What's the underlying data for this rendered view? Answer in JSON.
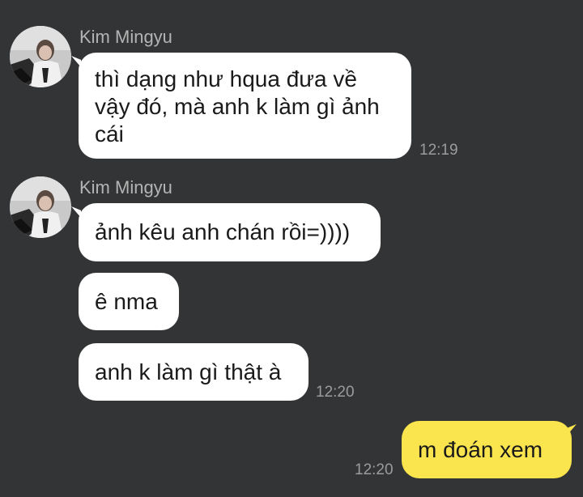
{
  "chat": {
    "groups": [
      {
        "sender": "Kim Mingyu",
        "avatar_icon": "profile-photo-icon",
        "messages": [
          {
            "lines": [
              "thì dạng như hqua đưa về",
              "vậy đó, mà anh k làm gì ảnh",
              "cái"
            ]
          }
        ],
        "time": "12:19"
      },
      {
        "sender": "Kim Mingyu",
        "avatar_icon": "profile-photo-icon",
        "messages": [
          {
            "text": "ảnh kêu anh chán rồi=))))"
          },
          {
            "text": "ê nma"
          },
          {
            "text": "anh k làm gì thật à"
          }
        ],
        "time": "12:20"
      }
    ],
    "outgoing": {
      "text": "m đoán xem",
      "time": "12:20"
    }
  },
  "colors": {
    "background": "#333435",
    "incoming_bubble": "#ffffff",
    "outgoing_bubble": "#fbe54e",
    "sender_name": "#b4b4b4",
    "timestamp": "#9c9c9c"
  }
}
